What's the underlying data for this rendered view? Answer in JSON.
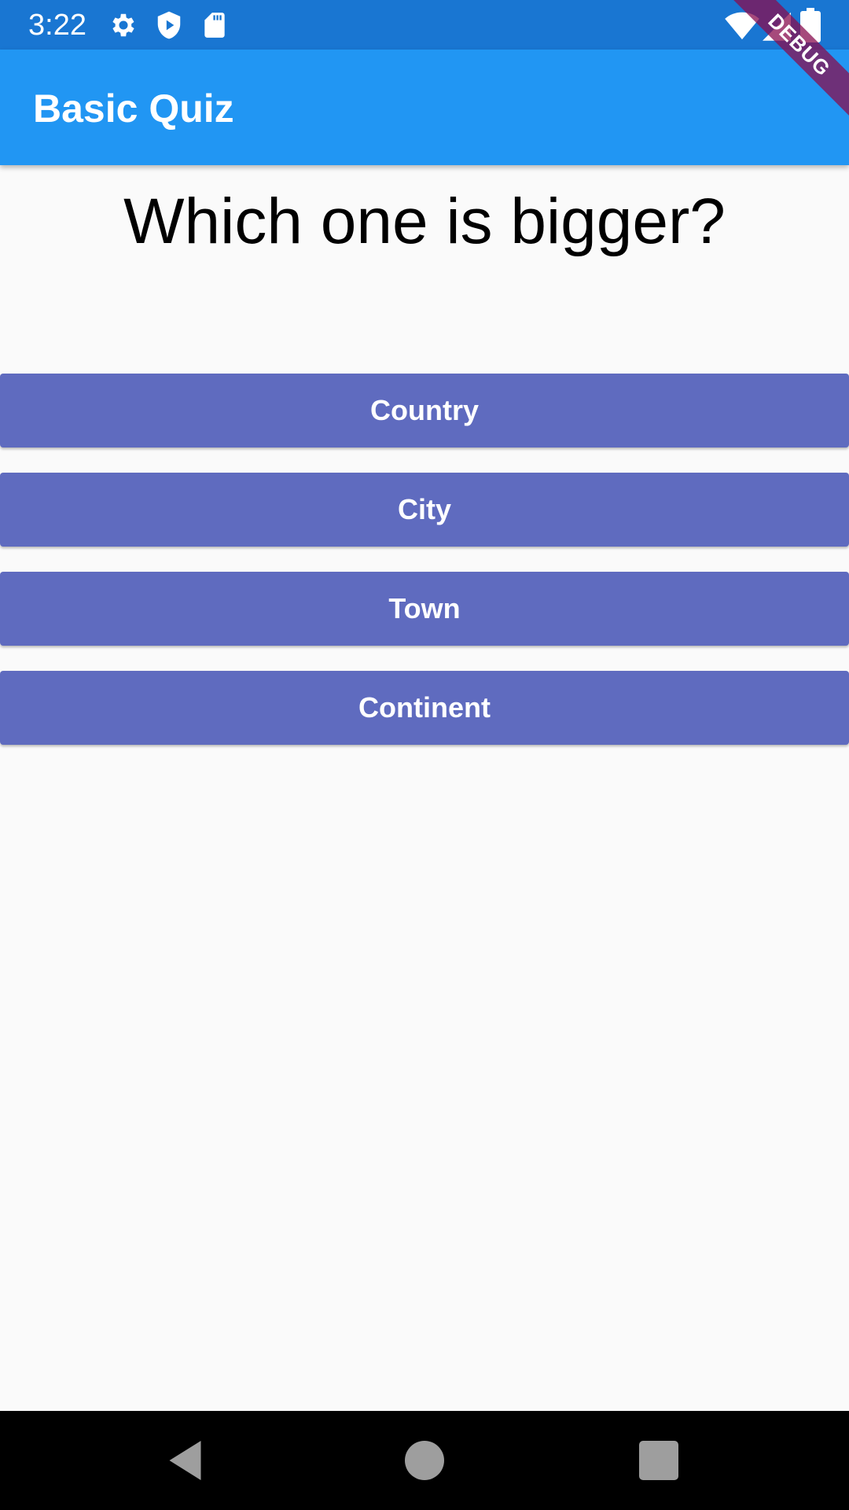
{
  "status_bar": {
    "time": "3:22",
    "icons": [
      "settings-icon",
      "shield-play-icon",
      "sd-card-icon",
      "wifi-icon",
      "signal-icon",
      "battery-icon"
    ]
  },
  "app_bar": {
    "title": "Basic Quiz"
  },
  "debug_banner": {
    "label": "DEBUG"
  },
  "quiz": {
    "question": "Which one is bigger?",
    "answers": [
      "Country",
      "City",
      "Town",
      "Continent"
    ]
  },
  "colors": {
    "status_bar": "#1976d2",
    "app_bar": "#2196f3",
    "answer_button": "#5f6bbf",
    "background": "#fafafa",
    "nav_bar": "#000000"
  },
  "nav_bar": {
    "buttons": [
      "back-icon",
      "home-icon",
      "recents-icon"
    ]
  }
}
